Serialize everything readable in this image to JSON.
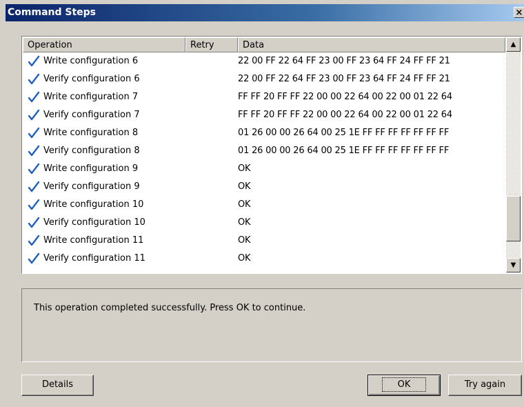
{
  "window": {
    "title": "Command Steps",
    "close_glyph": "×"
  },
  "list": {
    "columns": [
      "Operation",
      "Retry",
      "Data"
    ],
    "rows": [
      {
        "operation": "Write configuration 6",
        "retry": "",
        "data": "22 00 FF 22 64 FF 23 00 FF 23 64 FF 24 FF FF 21"
      },
      {
        "operation": "Verify configuration 6",
        "retry": "",
        "data": "22 00 FF 22 64 FF 23 00 FF 23 64 FF 24 FF FF 21"
      },
      {
        "operation": "Write configuration 7",
        "retry": "",
        "data": "FF FF 20 FF FF 22 00 00 22 64 00 22 00 01 22 64"
      },
      {
        "operation": "Verify configuration 7",
        "retry": "",
        "data": "FF FF 20 FF FF 22 00 00 22 64 00 22 00 01 22 64"
      },
      {
        "operation": "Write configuration 8",
        "retry": "",
        "data": "01 26 00 00 26 64 00 25 1E FF FF FF FF FF FF FF"
      },
      {
        "operation": "Verify configuration 8",
        "retry": "",
        "data": "01 26 00 00 26 64 00 25 1E FF FF FF FF FF FF FF"
      },
      {
        "operation": "Write configuration 9",
        "retry": "",
        "data": "OK"
      },
      {
        "operation": "Verify configuration 9",
        "retry": "",
        "data": "OK"
      },
      {
        "operation": "Write configuration 10",
        "retry": "",
        "data": "OK"
      },
      {
        "operation": "Verify configuration 10",
        "retry": "",
        "data": "OK"
      },
      {
        "operation": "Write configuration 11",
        "retry": "",
        "data": "OK"
      },
      {
        "operation": "Verify configuration 11",
        "retry": "",
        "data": "OK"
      }
    ],
    "row_icon": "checkmark-icon",
    "check_color": "#1f5fbf"
  },
  "message": "This operation completed successfully. Press OK to continue.",
  "buttons": {
    "details": "Details",
    "ok": "OK",
    "try_again": "Try again"
  },
  "scroll": {
    "up_glyph": "▲",
    "down_glyph": "▼"
  }
}
